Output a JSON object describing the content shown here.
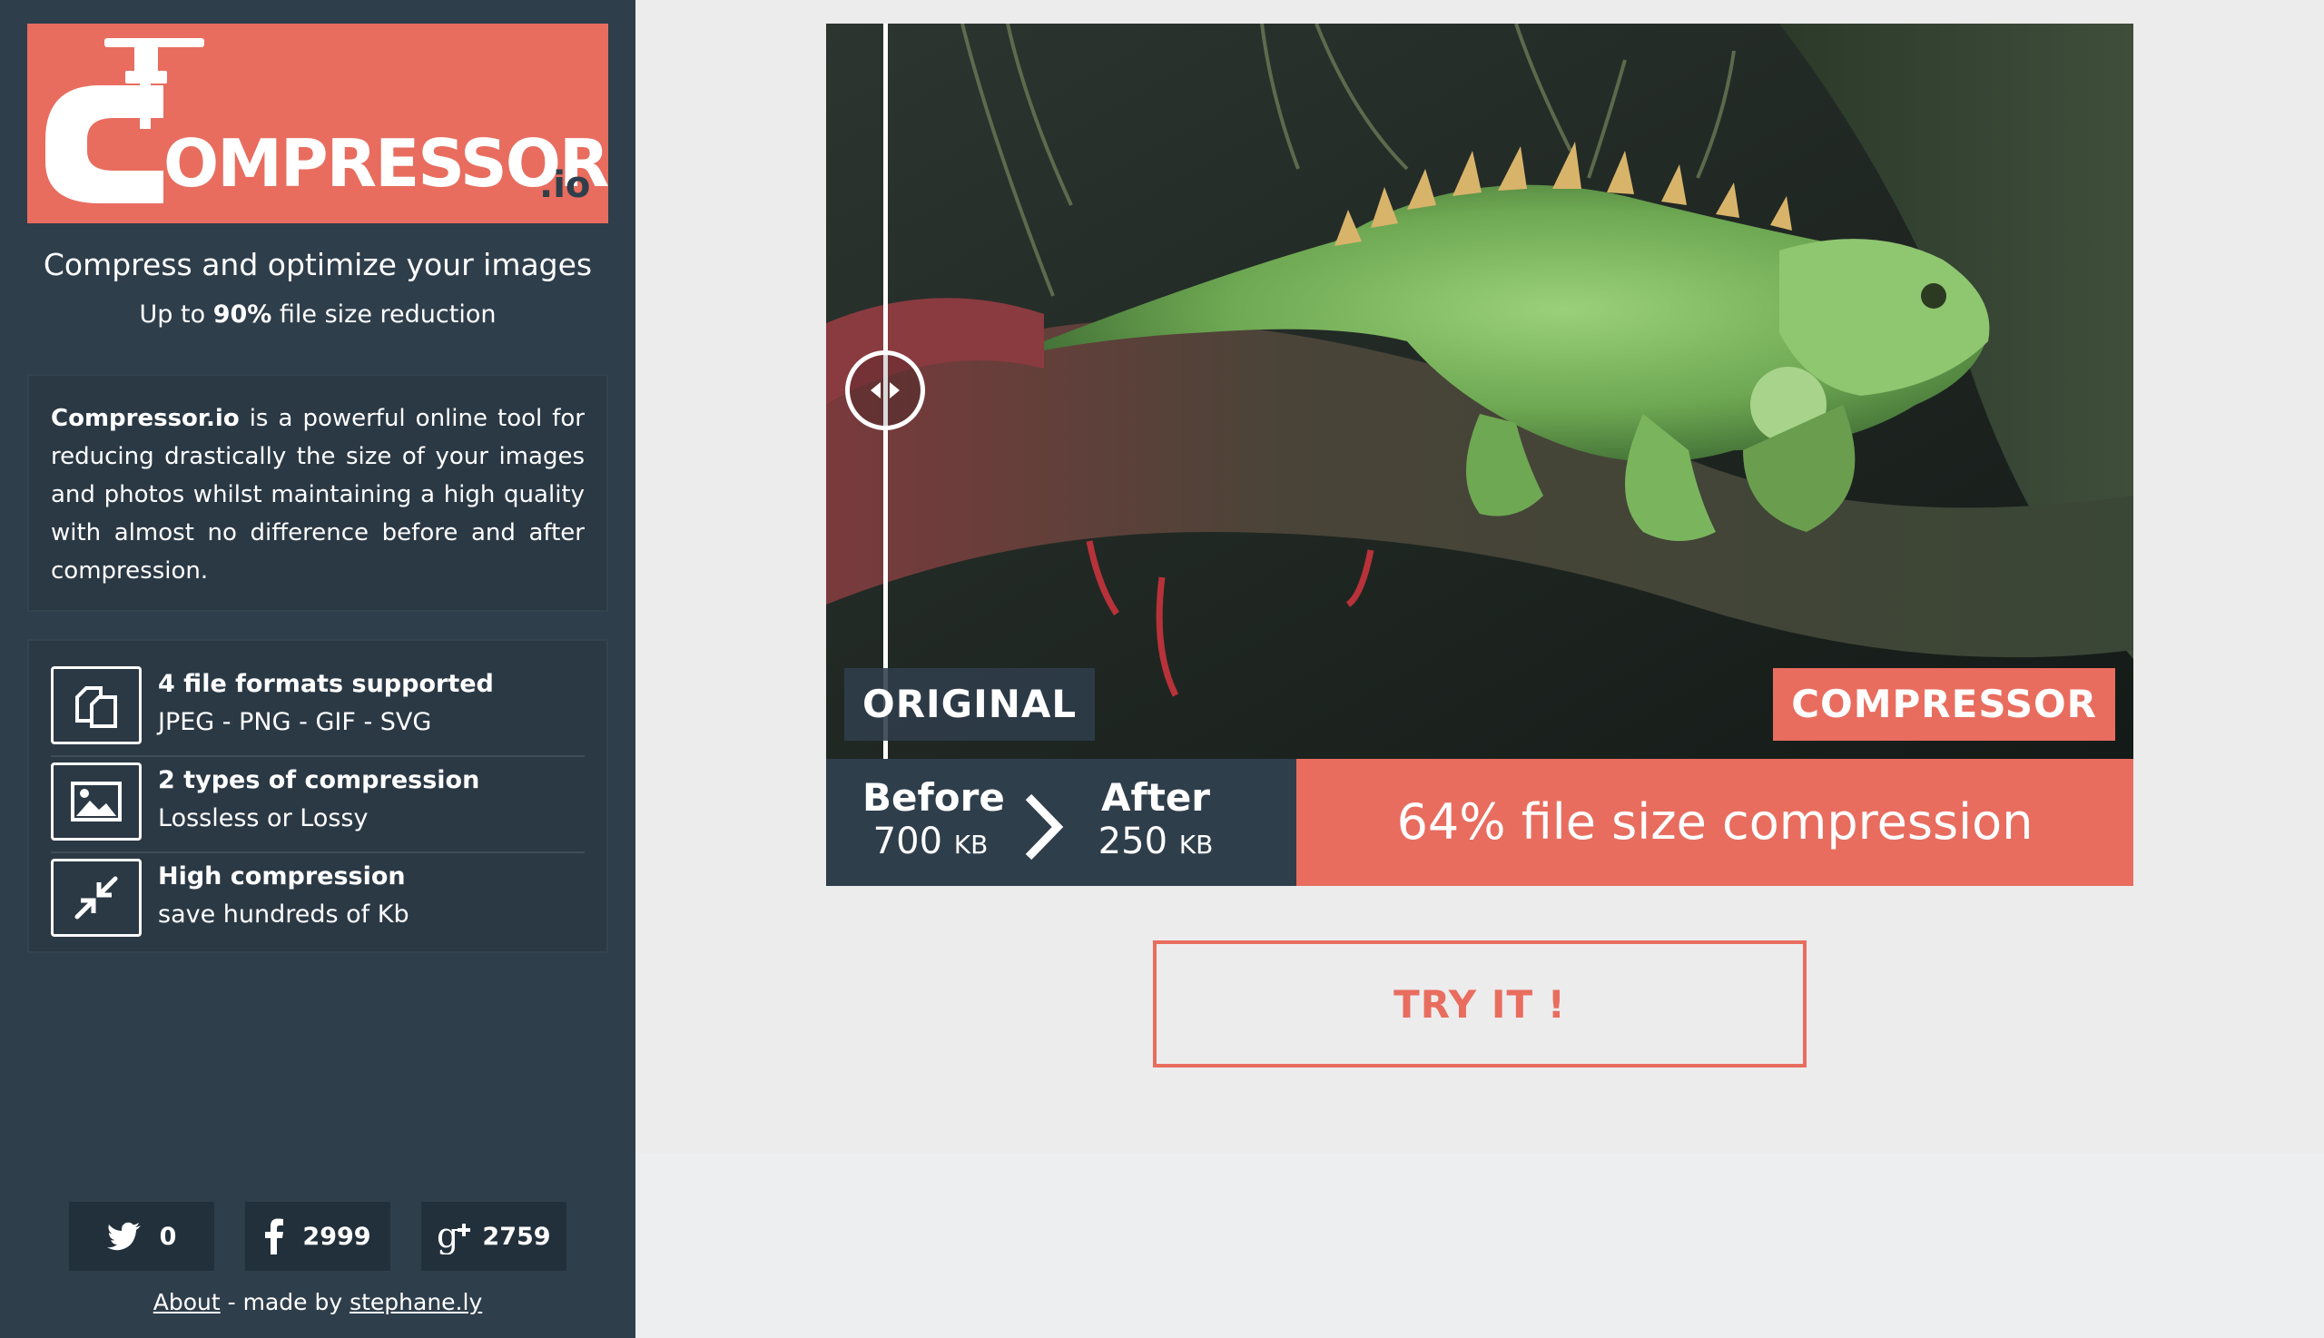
{
  "sidebar": {
    "logo_word": "OMPRESSOR",
    "logo_suffix": ".io",
    "tagline": "Compress and optimize your images",
    "subtag_prefix": "Up to ",
    "subtag_bold": "90%",
    "subtag_suffix": " file size reduction",
    "description_bold": "Compressor.io",
    "description_rest": " is a powerful online tool for reducing drastically the size of your images and photos whilst maintaining a high quality with almost no difference before and after compression.",
    "features": [
      {
        "icon": "file-formats-icon",
        "title": "4 file formats supported",
        "sub": "JPEG - PNG - GIF - SVG"
      },
      {
        "icon": "image-icon",
        "title": "2 types of compression",
        "sub": "Lossless or Lossy"
      },
      {
        "icon": "compress-arrows-icon",
        "title": "High compression",
        "sub": "save hundreds of Kb"
      }
    ],
    "social": [
      {
        "icon": "twitter-icon",
        "count": "0"
      },
      {
        "icon": "facebook-icon",
        "count": "2999"
      },
      {
        "icon": "google-plus-icon",
        "count": "2759"
      }
    ],
    "footer": {
      "about": "About",
      "made_by": " - made by ",
      "author": "stephane.ly"
    }
  },
  "viewer": {
    "label_original": "ORIGINAL",
    "label_compressor": "COMPRESSOR",
    "slider_fraction": 0.045
  },
  "stats": {
    "before_label": "Before",
    "before_value": "700",
    "before_unit": "KB",
    "after_label": "After",
    "after_value": "250",
    "after_unit": "KB",
    "compression_text": "64% file size compression"
  },
  "cta": {
    "label": "TRY IT !"
  },
  "colors": {
    "accent": "#e86d5f",
    "sidebar": "#2f3e4b",
    "background": "#ececec"
  }
}
